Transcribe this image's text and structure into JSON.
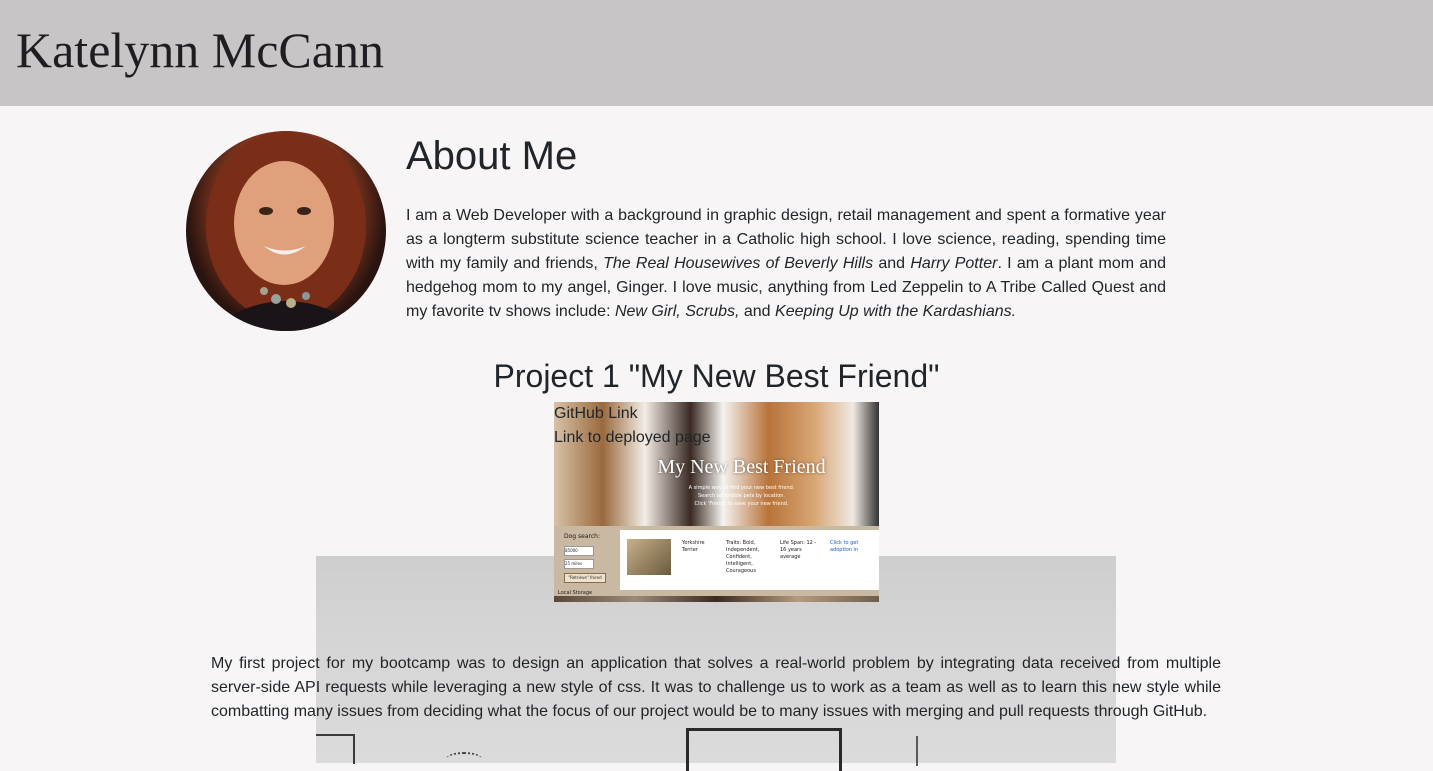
{
  "header": {
    "title": "Katelynn McCann",
    "background_color": "#c9c4c6"
  },
  "about": {
    "avatar_alt": "Katelynn McCann profile photo",
    "heading": "About Me",
    "paragraph": {
      "part1": "I am a Web Developer with a background in graphic design, retail management and spent a formative year as a longterm substitute science teacher in a Catholic high school. I love science, reading, spending time with my family and friends, ",
      "italic1": "The Real Housewives of Beverly Hills",
      "part2": " and ",
      "italic2": "Harry Potter",
      "part3": ". I am a plant mom and hedgehog mom to my angel, Ginger. I love music, anything from Led Zeppelin to A Tribe Called Quest and my favorite tv shows include: ",
      "italic3": "New Girl, Scrubs,",
      "part4": " and ",
      "italic4": "Keeping Up with the Kardashians.",
      "part5": ""
    }
  },
  "project1": {
    "title": "Project 1 \"My New Best Friend\"",
    "links": {
      "github": "GitHub Link",
      "deployed": "Link to deployed page"
    },
    "screenshot": {
      "hero_title": "My New Best Friend",
      "hero_sub_1": "A simple way to find your new best friend.",
      "hero_sub_2": "Search adoptable pets by location.",
      "hero_sub_3": "Click 'Friend' to save your new friend.",
      "search_label": "Dog search:",
      "zip_value": "85000",
      "distance_value": "25 miles",
      "button_label": "\"Retrieve\" friend",
      "storage_label": "Local Storage",
      "breed": "Yorkshire Terrier",
      "traits": "Traits: Bold, Independent, Confident, Intelligent, Courageous",
      "life_span": "Life Span: 12 - 16 years average",
      "adopt_link": "Click to get adoption in"
    },
    "description": "My first project for my bootcamp was to design an application that solves a real-world problem by integrating data received from multiple server-side API requests while leveraging a new style of css. It was to challenge us to work as a team as well as to learn this new style while combatting many issues from deciding what the focus of our project would be to many issues with merging and pull requests through GitHub."
  },
  "colors": {
    "page_background": "#f7f5f6",
    "text": "#212529"
  }
}
